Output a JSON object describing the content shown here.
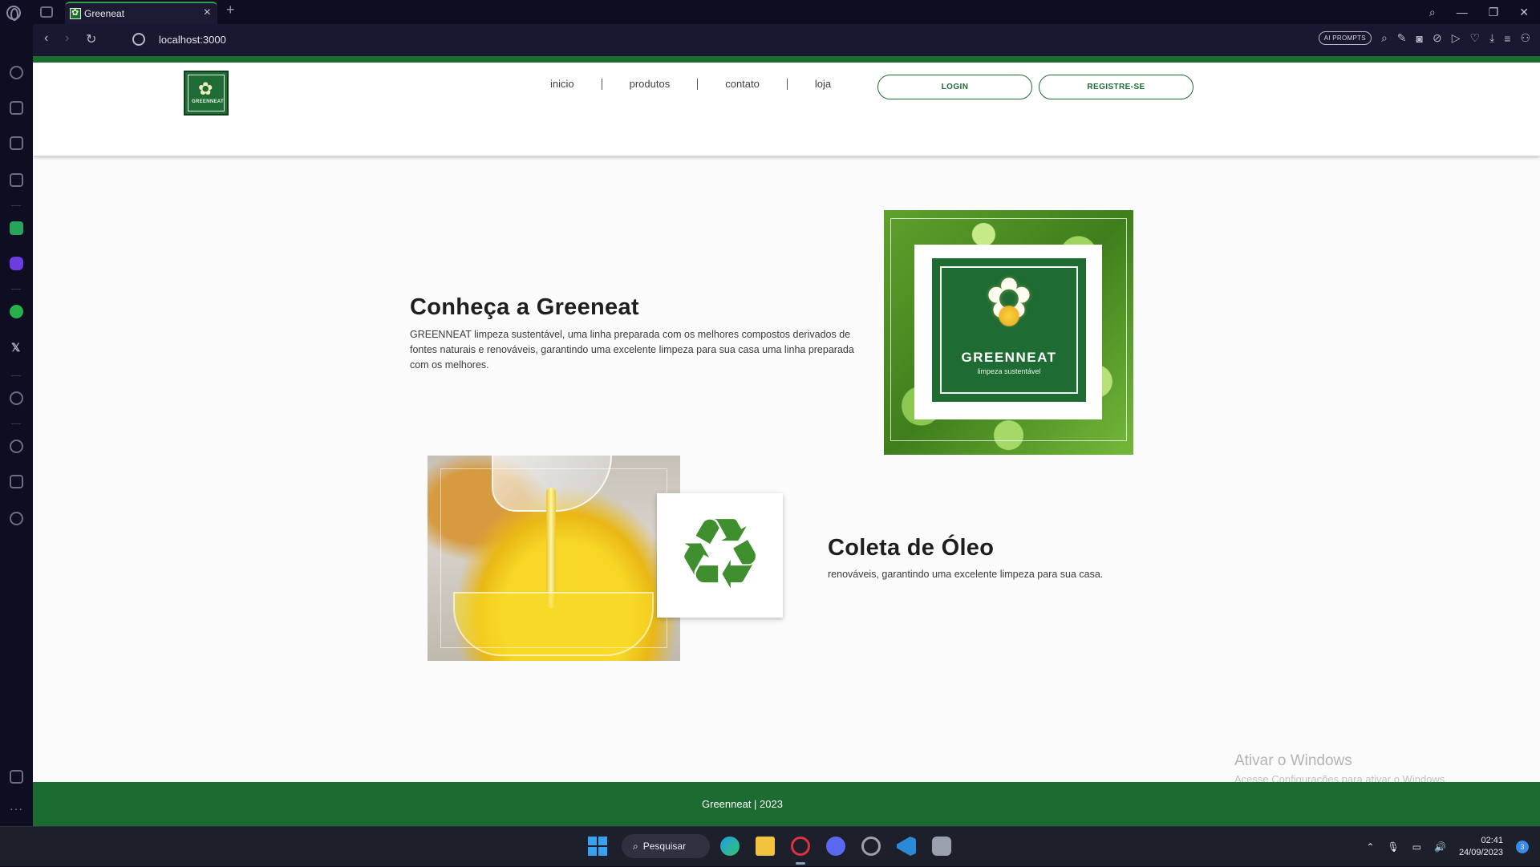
{
  "browser": {
    "tab_title": "Greeneat",
    "url": "localhost:3000",
    "ai_prompts_label": "AI PROMPTS"
  },
  "site": {
    "logo": {
      "brand": "GREENNEAT"
    },
    "nav": [
      {
        "label": "inicio"
      },
      {
        "label": "produtos"
      },
      {
        "label": "contato"
      },
      {
        "label": "loja"
      }
    ],
    "login_label": "LOGIN",
    "register_label": "REGISTRE-SE",
    "about": {
      "title": "Conheça a Greeneat",
      "text": "GREENNEAT limpeza sustentável, uma linha preparada com os melhores compostos derivados de fontes naturais e renováveis, garantindo uma excelente limpeza para sua casa uma linha preparada com os melhores.",
      "image": {
        "brand": "GREENNEAT",
        "tagline": "limpeza sustentável"
      }
    },
    "oil": {
      "title": "Coleta de Óleo",
      "text": "renováveis, garantindo uma excelente limpeza para sua casa."
    },
    "footer": "Greenneat | 2023",
    "watermark": {
      "title": "Ativar o Windows",
      "subtitle": "Acesse Configurações para ativar o Windows."
    }
  },
  "taskbar": {
    "search_label": "Pesquisar",
    "time": "02:41",
    "date": "24/09/2023",
    "notification_count": "3"
  },
  "icons": {
    "nav_back": "back-arrow-icon",
    "nav_forward": "forward-arrow-icon",
    "reload": "reload-icon",
    "recycle": "recycle-icon"
  },
  "colors": {
    "brand_green": "#1c6b31",
    "page_bg": "#fbfbfb"
  }
}
